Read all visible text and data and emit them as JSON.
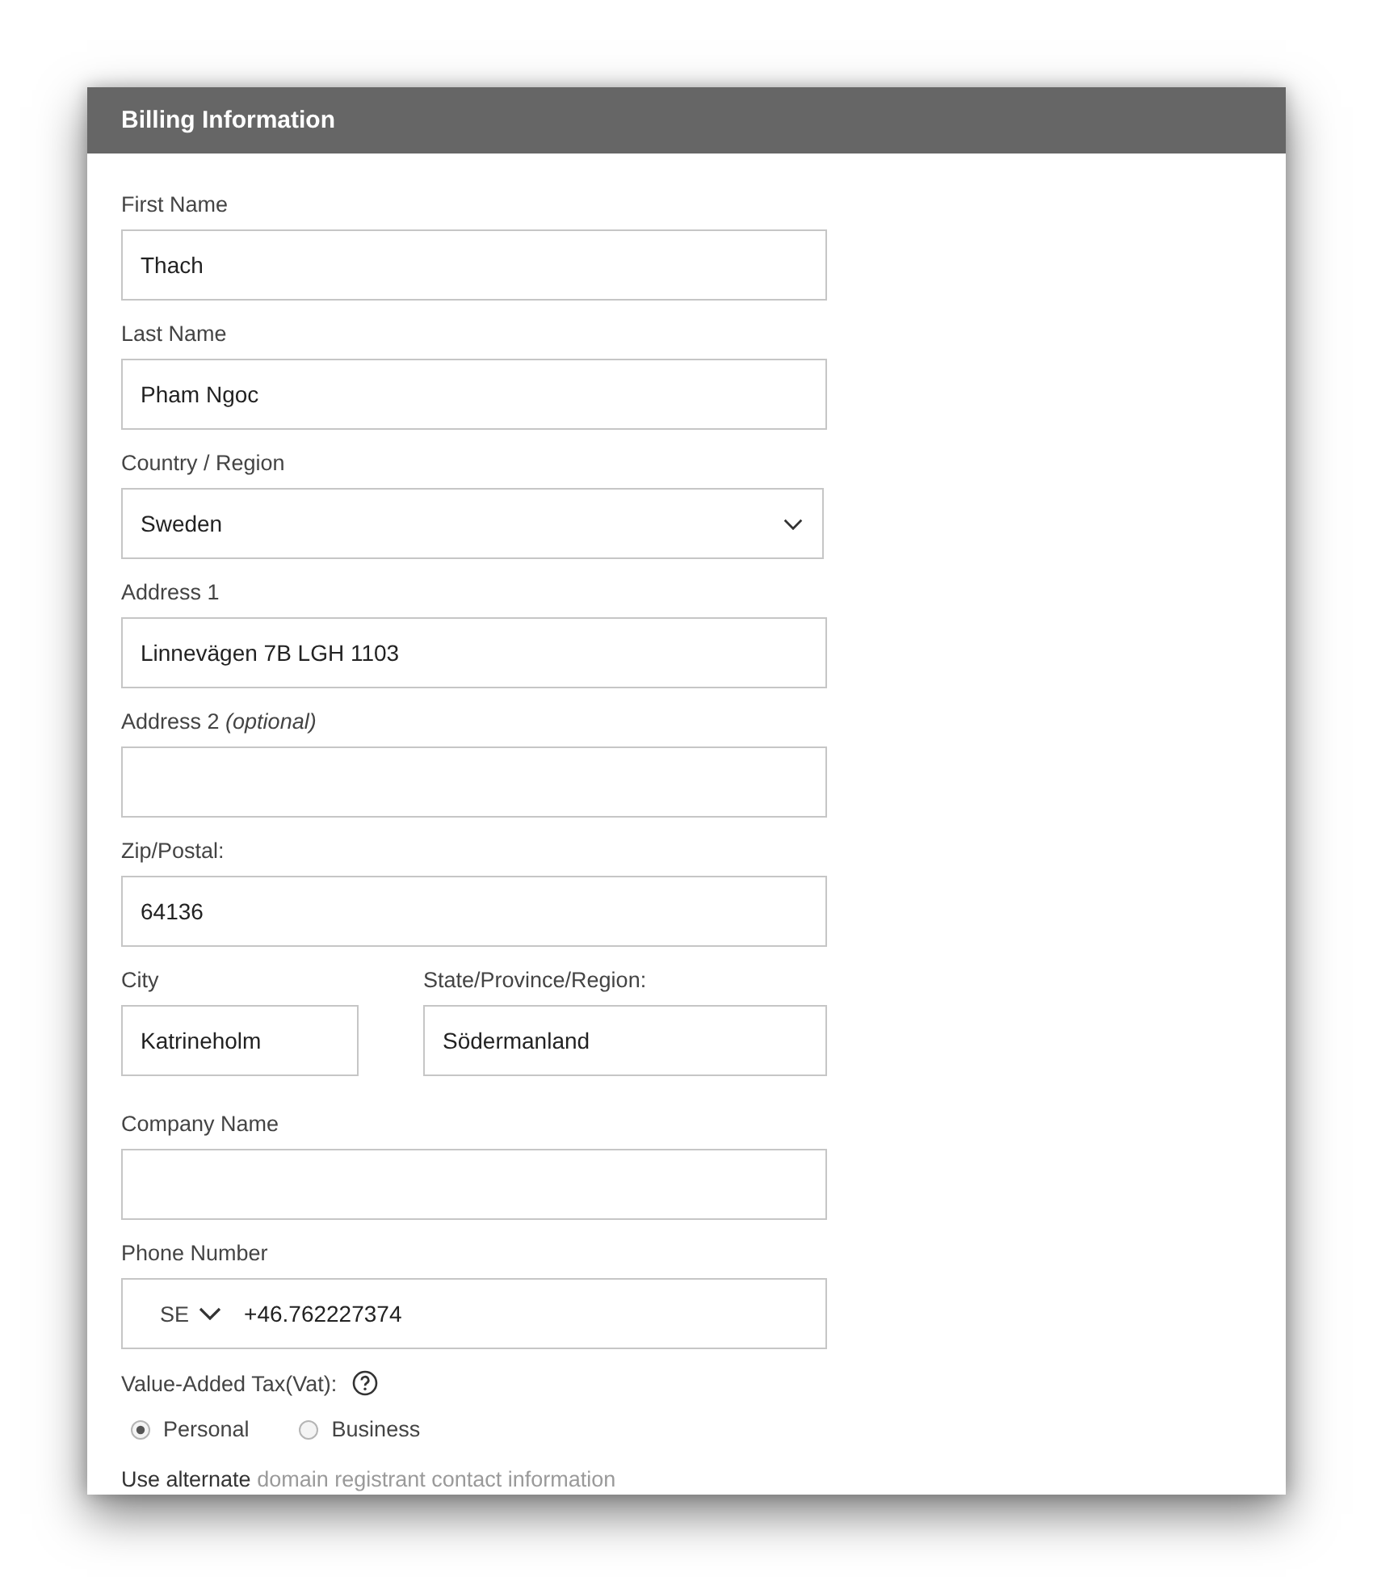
{
  "panel": {
    "title": "Billing Information"
  },
  "fields": [
    {
      "kind": "text",
      "label": "First Name",
      "value": "Thach"
    },
    {
      "kind": "text",
      "label": "Last Name",
      "value": "Pham Ngoc"
    },
    {
      "kind": "select",
      "label": "Country / Region",
      "value": "Sweden"
    },
    {
      "kind": "text",
      "label": "Address 1",
      "value": "Linnevägen 7B LGH 1103"
    },
    {
      "kind": "text",
      "label": "Address 2 *(optional)*"
    },
    {
      "kind": "text",
      "label": "Zip/Postal:",
      "value": "64136"
    },
    {
      "kind": "row",
      "fields": [
        {
          "kind": "short",
          "label": "City",
          "value": "Katrineholm"
        },
        {
          "kind": "medium",
          "label": "State/Province/Region:",
          "value": "Södermanland"
        }
      ]
    },
    {
      "kind": "text",
      "label": "Company Name"
    },
    {
      "kind": "phone",
      "label": "Phone Number",
      "country_code": "SE",
      "value": "+46.762227374"
    }
  ],
  "vat": {
    "label": "Value-Added Tax(Vat):",
    "options": [
      {
        "label": "Personal",
        "selected": true
      },
      {
        "label": "Business",
        "selected": false
      }
    ]
  },
  "alternate_contact": {
    "text": "Use alternate",
    "link": "domain registrant contact information"
  }
}
